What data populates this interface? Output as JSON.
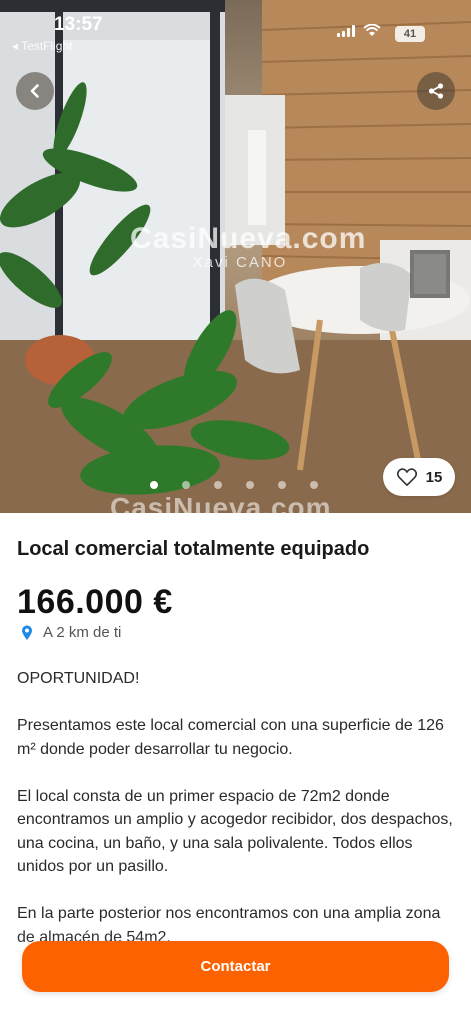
{
  "status_bar": {
    "time": "13:57",
    "back_app": "◂ TestFlight",
    "battery": "41"
  },
  "hero": {
    "watermark_main": "CasiNueva.com",
    "watermark_sub": "Xavi CANO",
    "bottom_watermark": "CasiNueva.com",
    "photo_count": 6,
    "active_photo_index": 0,
    "likes": "15"
  },
  "listing": {
    "title": "Local comercial totalmente equipado",
    "price": "166.000 €",
    "distance": "A 2 km de ti",
    "description": [
      "OPORTUNIDAD!",
      "Presentamos este local comercial con una superficie de 126 m² donde poder desarrollar tu negocio.",
      "El local consta de un primer espacio de 72m2 donde encontramos un amplio y acogedor recibidor, dos despachos, una cocina, un baño, y una sala polivalente. Todos ellos unidos por un pasillo.",
      "En la parte posterior nos encontramos con una amplia zona de almacén de 54m2."
    ]
  },
  "actions": {
    "contact_label": "Contactar"
  },
  "colors": {
    "accent": "#fd6200",
    "pin": "#1e88e5"
  }
}
